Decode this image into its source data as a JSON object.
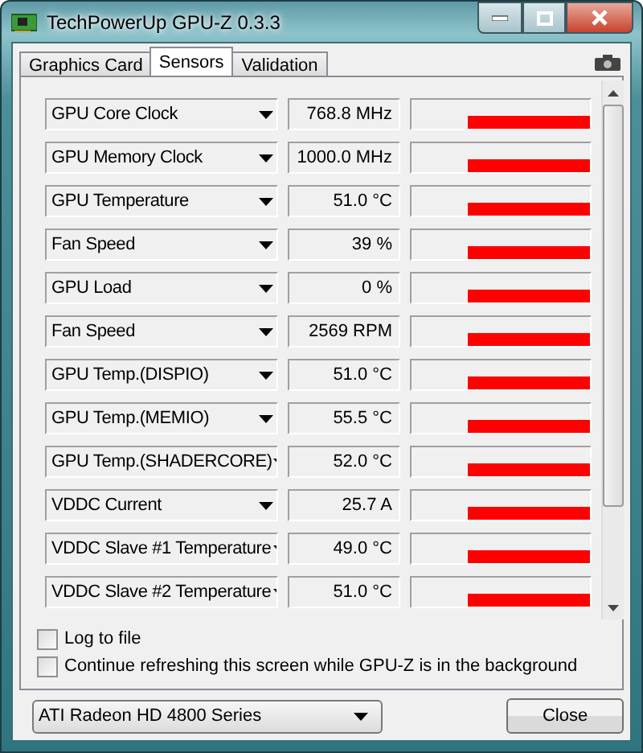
{
  "window": {
    "title": "TechPowerUp GPU-Z 0.3.3"
  },
  "tabs": [
    {
      "label": "Graphics Card",
      "selected": false
    },
    {
      "label": "Sensors",
      "selected": true
    },
    {
      "label": "Validation",
      "selected": false
    }
  ],
  "sensors": [
    {
      "name": "GPU Core Clock",
      "reading": "768.8 MHz"
    },
    {
      "name": "GPU Memory Clock",
      "reading": "1000.0 MHz"
    },
    {
      "name": "GPU Temperature",
      "reading": "51.0 °C"
    },
    {
      "name": "Fan Speed",
      "reading": "39 %"
    },
    {
      "name": "GPU Load",
      "reading": "0 %"
    },
    {
      "name": "Fan Speed",
      "reading": "2569 RPM"
    },
    {
      "name": "GPU Temp.(DISPIO)",
      "reading": "51.0 °C"
    },
    {
      "name": "GPU Temp.(MEMIO)",
      "reading": "55.5 °C"
    },
    {
      "name": "GPU Temp.(SHADERCORE)",
      "reading": "52.0 °C"
    },
    {
      "name": "VDDC Current",
      "reading": "25.7 A"
    },
    {
      "name": "VDDC Slave #1 Temperature",
      "reading": "49.0 °C"
    },
    {
      "name": "VDDC Slave #2 Temperature",
      "reading": "51.0 °C"
    }
  ],
  "options": [
    {
      "label": "Log to file",
      "checked": false
    },
    {
      "label": "Continue refreshing this screen while GPU-Z is in the background",
      "checked": false
    }
  ],
  "device": {
    "value": "ATI Radeon HD 4800 Series"
  },
  "buttons": [
    "Close"
  ]
}
